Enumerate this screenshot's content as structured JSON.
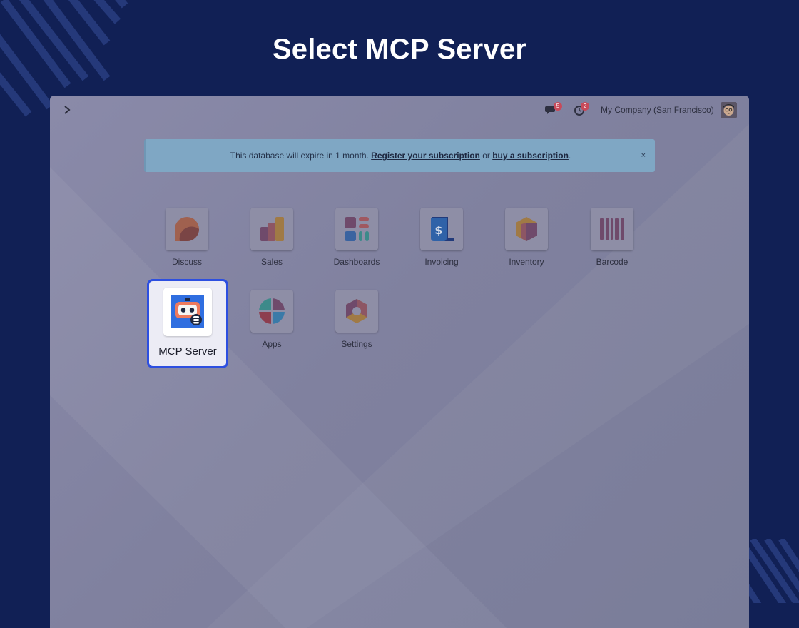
{
  "page_title": "Select MCP Server",
  "topbar": {
    "chat_badge": "5",
    "activity_badge": "2",
    "company": "My Company (San Francisco)"
  },
  "alert": {
    "text_before": "This database will expire in 1 month. ",
    "link1": "Register your subscription",
    "text_middle": " or ",
    "link2": "buy a subscription",
    "text_after": ".",
    "close": "×"
  },
  "apps": [
    {
      "label": "Discuss",
      "icon": "discuss-icon"
    },
    {
      "label": "Sales",
      "icon": "sales-icon"
    },
    {
      "label": "Dashboards",
      "icon": "dashboards-icon"
    },
    {
      "label": "Invoicing",
      "icon": "invoicing-icon"
    },
    {
      "label": "Inventory",
      "icon": "inventory-icon"
    },
    {
      "label": "Barcode",
      "icon": "barcode-icon"
    },
    {
      "label": "MCP Server",
      "icon": "mcp-server-icon",
      "selected": true
    },
    {
      "label": "Apps",
      "icon": "apps-icon"
    },
    {
      "label": "Settings",
      "icon": "settings-icon"
    }
  ],
  "colors": {
    "background": "#112055",
    "selection_border": "#2d4fe0",
    "badge": "#c84a5a"
  }
}
